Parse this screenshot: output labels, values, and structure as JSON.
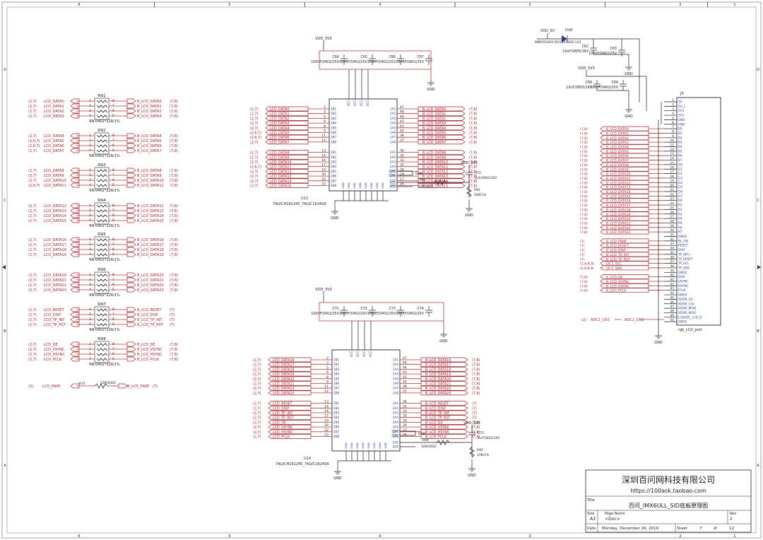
{
  "border": {
    "cols": [
      "6",
      "5",
      "4",
      "3",
      "2",
      "1"
    ],
    "rows": [
      "D",
      "C",
      "B",
      "A"
    ]
  },
  "title_block": {
    "company": "深圳百问网科技有限公司",
    "url": "https://100ask.taobao.com",
    "title_label": "Title",
    "title": "百问_IMX6ULL_SID底板原理图",
    "size_label": "Size",
    "size": "A3",
    "page_label": "Page Name",
    "page": "<Doc>",
    "rev_label": "Rev",
    "rev": "2",
    "date_label": "Date:",
    "date": "Monday, December 16, 2019",
    "sheet_label": "Sheet",
    "sheet": "7",
    "of_label": "of",
    "of": "12"
  },
  "rnets": [
    {
      "name": "RN1",
      "value": "RN:0402*22R/1%",
      "left": [
        [
          "(2,7)",
          "LCD_DATA0"
        ],
        [
          "(2,7)",
          "LCD_DATA1"
        ],
        [
          "(2,7)",
          "LCD_DATA2"
        ],
        [
          "(2,7)",
          "LCD_DATA3"
        ]
      ],
      "right": [
        [
          "B_LCD_DATA0",
          "(7,8)"
        ],
        [
          "B_LCD_DATA1",
          "(7,8)"
        ],
        [
          "B_LCD_DATA2",
          "(7,8)"
        ],
        [
          "B_LCD_DATA3",
          "(7,8)"
        ]
      ]
    },
    {
      "name": "RN2",
      "value": "RN:0402*22R/1%",
      "left": [
        [
          "(2,7)",
          "LCD_DATA4"
        ],
        [
          "(2,6,7)",
          "LCD_DATA5"
        ],
        [
          "(2,6,7)",
          "LCD_DATA6"
        ],
        [
          "(2,7)",
          "LCD_DATA7"
        ]
      ],
      "right": [
        [
          "B_LCD_DATA4",
          "(7,8)"
        ],
        [
          "B_LCD_DATA5",
          "(7,8)"
        ],
        [
          "B_LCD_DATA6",
          "(7,8)"
        ],
        [
          "B_LCD_DATA7",
          "(7,8)"
        ]
      ]
    },
    {
      "name": "RN3",
      "value": "RN:0402*22R/1%",
      "left": [
        [
          "(2,7)",
          "LCD_DATA8"
        ],
        [
          "(2,7)",
          "LCD_DATA9"
        ],
        [
          "(2,7)",
          "LCD_DATA10"
        ],
        [
          "(2,6,7)",
          "LCD_DATA11"
        ]
      ],
      "right": [
        [
          "B_LCD_DATA8",
          "(7,8)"
        ],
        [
          "B_LCD_DATA9",
          "(7,8)"
        ],
        [
          "B_LCD_DATA10",
          "(7,8)"
        ],
        [
          "B_LCD_DATA11",
          "(7,8)"
        ]
      ]
    },
    {
      "name": "RN4",
      "value": "RN:0402*22R/1%",
      "left": [
        [
          "(2,7)",
          "LCD_DATA12"
        ],
        [
          "(2,7)",
          "LCD_DATA13"
        ],
        [
          "(2,7)",
          "LCD_DATA14"
        ],
        [
          "(2,7)",
          "LCD_DATA15"
        ]
      ],
      "right": [
        [
          "B_LCD_DATA12",
          "(7,8)"
        ],
        [
          "B_LCD_DATA13",
          "(7,8)"
        ],
        [
          "B_LCD_DATA14",
          "(7,8)"
        ],
        [
          "B_LCD_DATA15",
          "(7,8)"
        ]
      ]
    },
    {
      "name": "RN5",
      "value": "RN:0402*22R/1%",
      "left": [
        [
          "(2,7)",
          "LCD_DATA16"
        ],
        [
          "(2,7)",
          "LCD_DATA17"
        ],
        [
          "(2,7)",
          "LCD_DATA18"
        ],
        [
          "(2,7)",
          "LCD_DATA19"
        ]
      ],
      "right": [
        [
          "B_LCD_DATA16",
          "(7,8)"
        ],
        [
          "B_LCD_DATA17",
          "(7,8)"
        ],
        [
          "B_LCD_DATA18",
          "(7,8)"
        ],
        [
          "B_LCD_DATA19",
          "(7,8)"
        ]
      ]
    },
    {
      "name": "RN6",
      "value": "RN:0402*22R/1%",
      "left": [
        [
          "(2,7)",
          "LCD_DATA20"
        ],
        [
          "(2,7)",
          "LCD_DATA21"
        ],
        [
          "(2,7)",
          "LCD_DATA22"
        ],
        [
          "(2,7)",
          "LCD_DATA23"
        ]
      ],
      "right": [
        [
          "B_LCD_DATA20",
          "(7,8)"
        ],
        [
          "B_LCD_DATA21",
          "(7,8)"
        ],
        [
          "B_LCD_DATA22",
          "(7,8)"
        ],
        [
          "B_LCD_DATA23",
          "(7,8)"
        ]
      ]
    },
    {
      "name": "RN7",
      "value": "RN:0402*22R/1%",
      "left": [
        [
          "(2,7)",
          "LCD_RESET"
        ],
        [
          "(2,7)",
          "LCD_DISP"
        ],
        [
          "(2,7)",
          "LCD_TP_INT"
        ],
        [
          "(2,7)",
          "LCD_TP_RST"
        ]
      ],
      "right": [
        [
          "B_LCD_RESET",
          "(7)"
        ],
        [
          "B_LCD_DISP",
          "(7)"
        ],
        [
          "B_LCD_TP_INT",
          "(7)"
        ],
        [
          "B_LCD_TP_RST",
          "(7)"
        ]
      ]
    },
    {
      "name": "RN8",
      "value": "RN:0402*22R/1%",
      "left": [
        [
          "(2,7)",
          "LCD_DE"
        ],
        [
          "(2,7)",
          "LCD_VSYNC"
        ],
        [
          "(2,7)",
          "LCD_HSYNC"
        ],
        [
          "(2,7)",
          "LCD_PCLK"
        ]
      ],
      "right": [
        [
          "B_LCD_DE",
          "(7,8)"
        ],
        [
          "B_LCD_VSYNC",
          "(7,8)"
        ],
        [
          "B_LCD_HSYNC",
          "(7,8)"
        ],
        [
          "B_LCD_PCLK",
          "(7,8)"
        ]
      ]
    }
  ],
  "pwm": {
    "left_ref": "(2)",
    "left_net": "LCD_PWM",
    "res": "R37",
    "value": "22R/0402",
    "right_net": "B_LCD_PWM",
    "right_ref": "(7)"
  },
  "u12": {
    "name": "U12",
    "part": "74LVCH162245_74LVC16245A",
    "vdd": "VDD_3V3",
    "caps": [
      {
        "ref": "C64",
        "val": "100nF/0402/25V"
      },
      {
        "ref": "C65",
        "val": "100nF/0402/25V"
      },
      {
        "ref": "C66",
        "val": "100nF/0402/25V"
      },
      {
        "ref": "C67",
        "val": "100nF/0402/25V"
      }
    ],
    "in1": [
      [
        "(2,7)",
        "LCD_DATA0",
        "2",
        "1B1"
      ],
      [
        "(2,7)",
        "LCD_DATA1",
        "3",
        "1B2"
      ],
      [
        "(2,7)",
        "LCD_DATA2",
        "5",
        "1B3"
      ],
      [
        "(2,7)",
        "LCD_DATA3",
        "6",
        "1B4"
      ],
      [
        "(2,7)",
        "LCD_DATA4",
        "8",
        "1B5"
      ],
      [
        "(2,6,7)",
        "LCD_DATA5",
        "9",
        "1B6"
      ],
      [
        "(2,6,7)",
        "LCD_DATA6",
        "11",
        "1B7"
      ],
      [
        "(2,7)",
        "LCD_DATA7",
        "12",
        "1B8"
      ]
    ],
    "in2": [
      [
        "(2,7)",
        "LCD_DATA8",
        "13",
        "2B1"
      ],
      [
        "(2,7)",
        "LCD_DATA9",
        "14",
        "2B2"
      ],
      [
        "(2,7)",
        "LCD_DATA10",
        "16",
        "2B3"
      ],
      [
        "(2,6,7)",
        "LCD_DATA11",
        "17",
        "2B4"
      ],
      [
        "(2,7)",
        "LCD_DATA12",
        "19",
        "2B5"
      ],
      [
        "(2,7)",
        "LCD_DATA13",
        "20",
        "2B6"
      ],
      [
        "(2,7)",
        "LCD_DATA14",
        "22",
        "2B7"
      ],
      [
        "(2,7)",
        "LCD_DATA15",
        "23",
        "2B8"
      ]
    ],
    "out1": [
      [
        "1A1",
        "47",
        "B_LCD_DATA0",
        "(7,8)"
      ],
      [
        "1A2",
        "46",
        "B_LCD_DATA1",
        "(7,8)"
      ],
      [
        "1A3",
        "44",
        "B_LCD_DATA2",
        "(7,8)"
      ],
      [
        "1A4",
        "43",
        "B_LCD_DATA3",
        "(7,8)"
      ],
      [
        "1A5",
        "41",
        "B_LCD_DATA4",
        "(7,8)"
      ],
      [
        "1A6",
        "40",
        "B_LCD_DATA5",
        "(7,8)"
      ],
      [
        "1A7",
        "38",
        "B_LCD_DATA6",
        "(7,8)"
      ],
      [
        "1A8",
        "37",
        "B_LCD_DATA7",
        "(7,8)"
      ]
    ],
    "out2": [
      [
        "2A1",
        "36",
        "B_LCD_DATA8",
        "(7,8)"
      ],
      [
        "2A2",
        "35",
        "B_LCD_DATA9",
        "(7,8)"
      ],
      [
        "2A3",
        "33",
        "B_LCD_DATA10",
        "(7,8)"
      ],
      [
        "2A4",
        "32",
        "B_LCD_DATA11",
        "(7,8)"
      ],
      [
        "2A5",
        "30",
        "B_LCD_DATA12",
        "(7,8)"
      ],
      [
        "2A6",
        "29",
        "B_LCD_DATA13",
        "(7,8)"
      ],
      [
        "2A7",
        "27",
        "B_LCD_DATA14",
        "(7,8)"
      ],
      [
        "2A8",
        "26",
        "B_LCD_DATA15",
        "(7,8)"
      ]
    ],
    "dir": [
      "1DIR",
      "2DIR"
    ],
    "oe": [
      "1OE",
      "2OE"
    ],
    "rc": {
      "vdd": "VDD_3V3",
      "cap": "C70",
      "cap_val": "1uF/0402/16V",
      "r1": "R91",
      "r1_val": "10K/0402",
      "r2": "R92",
      "r2_val": "10K/1%"
    },
    "gnd": "GND"
  },
  "u14": {
    "name": "U14",
    "part": "74LVCH162245_74LVC16245A",
    "vdd": "VDD_3V3",
    "caps": [
      {
        "ref": "C71",
        "val": "100nF/0402/25V"
      },
      {
        "ref": "C72",
        "val": "100nF/0402/25V"
      },
      {
        "ref": "C73",
        "val": "100nF/0402/25V"
      },
      {
        "ref": "C74",
        "val": "100nF/0402/25V"
      }
    ],
    "in1": [
      [
        "(2,7)",
        "LCD_DATA16"
      ],
      [
        "(2,7)",
        "LCD_DATA17"
      ],
      [
        "(2,7)",
        "LCD_DATA18"
      ],
      [
        "(2,7)",
        "LCD_DATA19"
      ],
      [
        "(2,7)",
        "LCD_DATA20"
      ],
      [
        "(2,7)",
        "LCD_DATA21"
      ],
      [
        "(2,7)",
        "LCD_DATA22"
      ],
      [
        "(2,7)",
        "LCD_DATA23"
      ]
    ],
    "in2": [
      [
        "(2,7)",
        "LCD_RESET"
      ],
      [
        "(2,7)",
        "LCD_DISP"
      ],
      [
        "(2,7)",
        "LCD_TP_INT"
      ],
      [
        "(2,7)",
        "LCD_TP_RST"
      ],
      [
        "(2,7)",
        "LCD_DE"
      ],
      [
        "(2,7)",
        "LCD_VSYNC"
      ],
      [
        "(2,7)",
        "LCD_HSYNC"
      ],
      [
        "(2,7)",
        "LCD_PCLK"
      ]
    ],
    "out1": [
      [
        "B_LCD_DATA16",
        "(7,8)"
      ],
      [
        "B_LCD_DATA17",
        "(7,8)"
      ],
      [
        "B_LCD_DATA18",
        "(7,8)"
      ],
      [
        "B_LCD_DATA19",
        "(7,8)"
      ],
      [
        "B_LCD_DATA20",
        "(7,8)"
      ],
      [
        "B_LCD_DATA21",
        "(7,8)"
      ],
      [
        "B_LCD_DATA22",
        "(7,8)"
      ],
      [
        "B_LCD_DATA23",
        "(7,8)"
      ]
    ],
    "out2": [
      [
        "B_LCD_RESET",
        "(7)"
      ],
      [
        "B_LCD_DISP",
        "(7)"
      ],
      [
        "B_LCD_TP_INT",
        "(7)"
      ],
      [
        "B_LCD_TP_RST",
        "(7)"
      ],
      [
        "B_LCD_DE",
        "(7,8)"
      ],
      [
        "B_LCD_VSYNC",
        "(7,8)"
      ],
      [
        "B_LCD_HSYNC",
        "(7,8)"
      ],
      [
        "B_LCD_PCLK",
        "(7,8)"
      ]
    ],
    "rc": {
      "vdd": "VDD_3V3",
      "cap": "C75",
      "cap_val": "1uF/0402/16V",
      "r1": "R94",
      "r1_val": "10K/0402",
      "r2": "R95",
      "r2_val": "10K/1%"
    },
    "gnd": "GND"
  },
  "power": {
    "vdd5": "VDD_5V",
    "diode": "D18",
    "diode_part": "MBR0520/0.5A/20V/SOD-123",
    "c62": "C62",
    "c62_val": "10uF/0805/16V",
    "c63": "C63",
    "c63_val": "100nF/0402/25V",
    "vdd33": "VDD_3V3",
    "c68": "C68",
    "c68_val": "10uF/0805/16V",
    "c69": "C69",
    "c69_val": "100nF/0402/25V",
    "gnd": "GND"
  },
  "conn": {
    "name": "J5",
    "part": "rgb_LCD_port",
    "pins": [
      [
        "1",
        "5V",
        ""
      ],
      [
        "2",
        "5V_1",
        ""
      ],
      [
        "3",
        "3V3",
        ""
      ],
      [
        "4",
        "3V3",
        ""
      ],
      [
        "5",
        "GND",
        ""
      ],
      [
        "6",
        "GND",
        ""
      ],
      [
        "7",
        "B0",
        "(7,8)",
        "B_LCD_DATA0"
      ],
      [
        "8",
        "B1",
        "(7,8)",
        "B_LCD_DATA1"
      ],
      [
        "9",
        "B2",
        "(7,8)",
        "B_LCD_DATA2"
      ],
      [
        "10",
        "B3",
        "(7,8)",
        "B_LCD_DATA3"
      ],
      [
        "11",
        "B4",
        "(7,8)",
        "B_LCD_DATA4"
      ],
      [
        "12",
        "B5",
        "(7,8)",
        "B_LCD_DATA5"
      ],
      [
        "13",
        "B6",
        "(7,8)",
        "B_LCD_DATA6"
      ],
      [
        "14",
        "B7",
        "(7,8)",
        "B_LCD_DATA7"
      ],
      [
        "15",
        "G0",
        "(7,8)",
        "B_LCD_DATA8"
      ],
      [
        "16",
        "G1",
        "(7,8)",
        "B_LCD_DATA9"
      ],
      [
        "17",
        "G2",
        "(7,8)",
        "B_LCD_DATA10"
      ],
      [
        "18",
        "G3",
        "(7,8)",
        "B_LCD_DATA11"
      ],
      [
        "19",
        "G4",
        "(7,8)",
        "B_LCD_DATA12"
      ],
      [
        "20",
        "G5",
        "(7,8)",
        "B_LCD_DATA13"
      ],
      [
        "21",
        "G6",
        "(7,8)",
        "B_LCD_DATA14"
      ],
      [
        "22",
        "G7",
        "(7,8)",
        "B_LCD_DATA15"
      ],
      [
        "23",
        "R0",
        "(7,8)",
        "B_LCD_DATA16"
      ],
      [
        "24",
        "R1",
        "(7,8)",
        "B_LCD_DATA17"
      ],
      [
        "25",
        "R2",
        "(7,8)",
        "B_LCD_DATA18"
      ],
      [
        "26",
        "R3",
        "(7,8)",
        "B_LCD_DATA19"
      ],
      [
        "27",
        "R4",
        "(7,8)",
        "B_LCD_DATA20"
      ],
      [
        "28",
        "R5",
        "(7,8)",
        "B_LCD_DATA21"
      ],
      [
        "29",
        "R6",
        "(7,8)",
        "B_LCD_DATA22"
      ],
      [
        "30",
        "R7",
        "(7,8)",
        "B_LCD_DATA23"
      ],
      [
        "31",
        "GND3",
        ""
      ],
      [
        "32",
        "BL_ON",
        "(7)",
        "B_LCD_PWM"
      ],
      [
        "33",
        "RESET",
        "(7)",
        "B_LCD_RESET"
      ],
      [
        "34",
        "DISP",
        "(7)",
        "B_LCD_DISP"
      ],
      [
        "35",
        "TP_INTn",
        "(7)",
        "B_LCD_TP_INT"
      ],
      [
        "36",
        "TP_RESET",
        "(7)",
        "B_LCD_TP_RST"
      ],
      [
        "37",
        "TP_SCL",
        "(2,6,8,9)",
        "I2C1_SCL"
      ],
      [
        "38",
        "TP_SDA",
        "(2,6,8,9)",
        "I2C1_SDA"
      ],
      [
        "39",
        "GND2",
        ""
      ],
      [
        "40",
        "DEN",
        "(7,8)",
        "B_LCD_DE"
      ],
      [
        "41",
        "VSYNC",
        "(7,8)",
        "B_LCD_VSYNC"
      ],
      [
        "42",
        "HSYNC",
        "(7,8)",
        "B_LCD_HSYNC"
      ],
      [
        "43",
        "PCLK",
        "(7,8)",
        "B_LCD_PCLK"
      ],
      [
        "44",
        "GND4",
        ""
      ],
      [
        "45",
        "XDSPI_CS",
        ""
      ],
      [
        "46",
        "XDSPI_CLK",
        ""
      ],
      [
        "47",
        "XDSPI_MOSI",
        ""
      ],
      [
        "48",
        "XDSPI_MISO",
        ""
      ],
      [
        "49",
        "LCDADC_LCD_D",
        ""
      ],
      [
        "50",
        "GND5",
        ""
      ]
    ],
    "adc_ref": "(2)",
    "adc_left": "ADC1_CH2",
    "adc_right": "ADC1_CH2",
    "gnd": "GND"
  }
}
